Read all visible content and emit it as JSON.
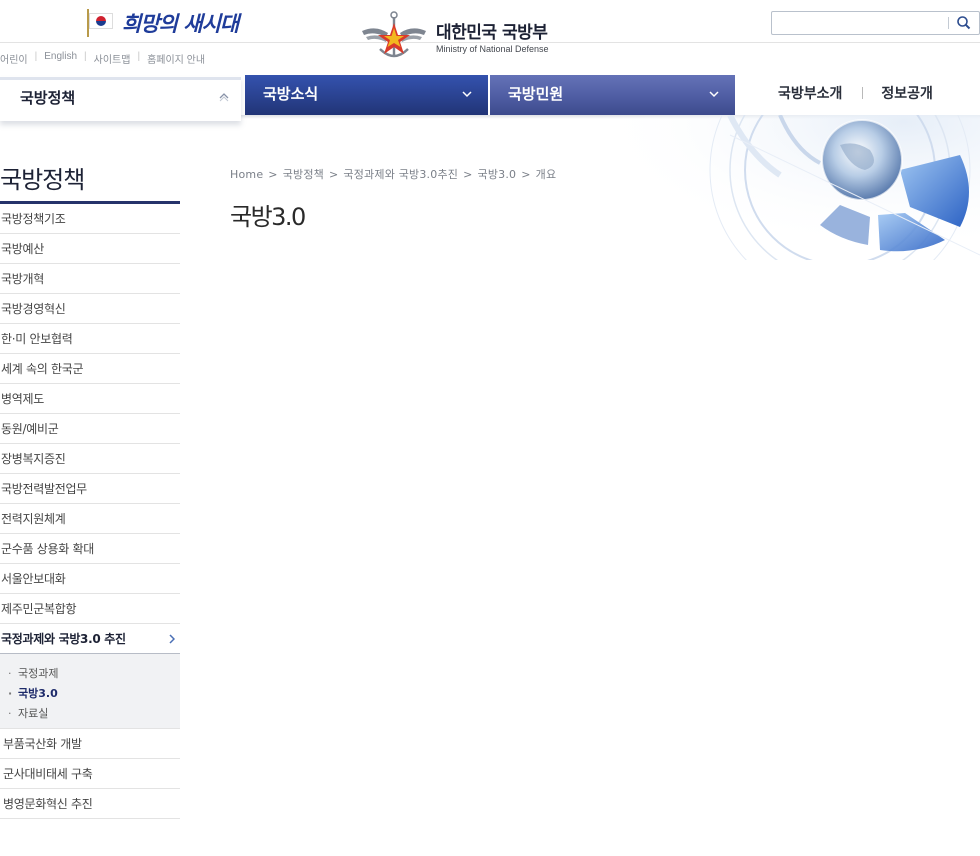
{
  "header": {
    "slogan": "희망의 새시대",
    "util_links": [
      "어린이",
      "English",
      "사이트맵",
      "홈페이지 안내"
    ],
    "logo_ko": "대한민국 국방부",
    "logo_en": "Ministry of National Defense",
    "search": {
      "placeholder": "",
      "value": ""
    }
  },
  "gnb": {
    "tabs": [
      {
        "label": "국방정책",
        "active": true
      },
      {
        "label": "국방소식",
        "active": false
      },
      {
        "label": "국방민원",
        "active": false
      }
    ],
    "right_links": [
      "국방부소개",
      "정보공개"
    ]
  },
  "lnb": {
    "title": "국방정책",
    "items": [
      "국방정책기조",
      "국방예산",
      "국방개혁",
      "국방경영혁신",
      "한·미 안보협력",
      "세계 속의 한국군",
      "병역제도",
      "동원/예비군",
      "장병복지증진",
      "국방전력발전업무",
      "전력지원체계",
      "군수품 상용화 확대",
      "서울안보대화",
      "제주민군복합항"
    ],
    "active_item": "국정과제와 국방3.0 추진",
    "sub_items": [
      {
        "label": "국정과제",
        "active": false
      },
      {
        "label": "국방3.0",
        "active": true
      },
      {
        "label": "자료실",
        "active": false
      }
    ],
    "after_items": [
      "부품국산화 개발",
      "군사대비태세 구축",
      "병영문화혁신 추진"
    ]
  },
  "breadcrumb": [
    "Home",
    "국방정책",
    "국정과제와 국방3.0추진",
    "국방3.0",
    "개요"
  ],
  "page_title": "국방3.0",
  "colors": {
    "nav_blue": "#2a4290",
    "nav_lavender": "#4f5da3",
    "accent_navy": "#26336b"
  }
}
